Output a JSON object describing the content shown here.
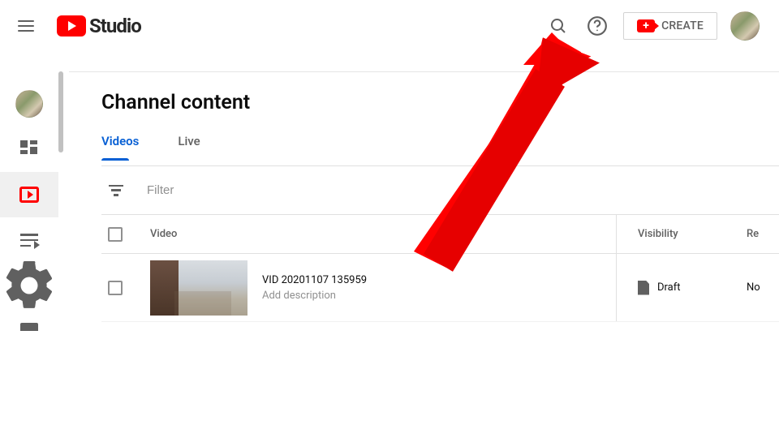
{
  "brand": {
    "name": "Studio"
  },
  "header": {
    "create_label": "CREATE"
  },
  "page": {
    "title": "Channel content"
  },
  "tabs": {
    "videos": "Videos",
    "live": "Live"
  },
  "filter": {
    "placeholder": "Filter"
  },
  "columns": {
    "video": "Video",
    "visibility": "Visibility",
    "restrictions": "Re"
  },
  "rows": [
    {
      "title": "VID 20201107 135959",
      "description": "Add description",
      "visibility": "Draft",
      "restrictions": "No"
    }
  ]
}
